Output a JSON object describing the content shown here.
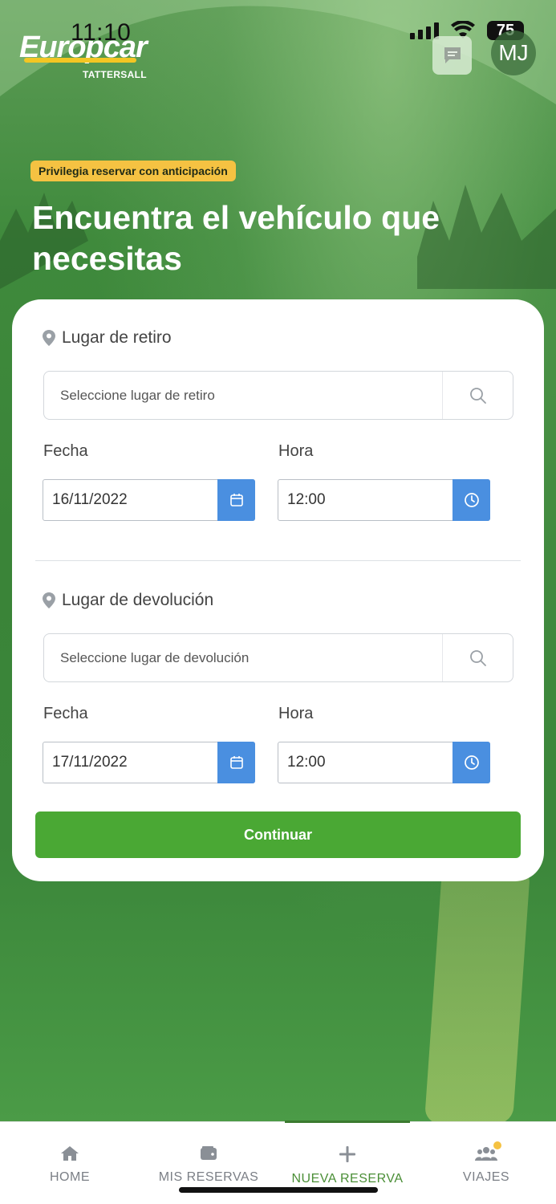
{
  "status_bar": {
    "time": "11:10",
    "battery": "75"
  },
  "header": {
    "logo_main": "Europcar",
    "logo_sub": "TATTERSALL",
    "avatar_initials": "MJ"
  },
  "hero": {
    "badge": "Privilegia reservar con anticipación",
    "title": "Encuentra el vehículo que necesitas"
  },
  "pickup": {
    "section_label": "Lugar de retiro",
    "location_placeholder": "Seleccione lugar de retiro",
    "date_label": "Fecha",
    "date_value": "16/11/2022",
    "time_label": "Hora",
    "time_value": "12:00"
  },
  "dropoff": {
    "section_label": "Lugar de devolución",
    "location_placeholder": "Seleccione lugar de devolución",
    "date_label": "Fecha",
    "date_value": "17/11/2022",
    "time_label": "Hora",
    "time_value": "12:00"
  },
  "actions": {
    "continue_label": "Continuar"
  },
  "bottom_nav": {
    "items": [
      {
        "label": "HOME",
        "icon": "home-icon"
      },
      {
        "label": "MIS RESERVAS",
        "icon": "wallet-icon"
      },
      {
        "label": "NUEVA RESERVA",
        "icon": "plus-icon",
        "active": true
      },
      {
        "label": "VIAJES",
        "icon": "users-icon",
        "has_notification": true
      }
    ]
  },
  "colors": {
    "brand_green": "#4aa834",
    "accent_blue": "#4a8fe0",
    "badge_yellow": "#f5c242",
    "active_nav": "#4a8e36"
  }
}
